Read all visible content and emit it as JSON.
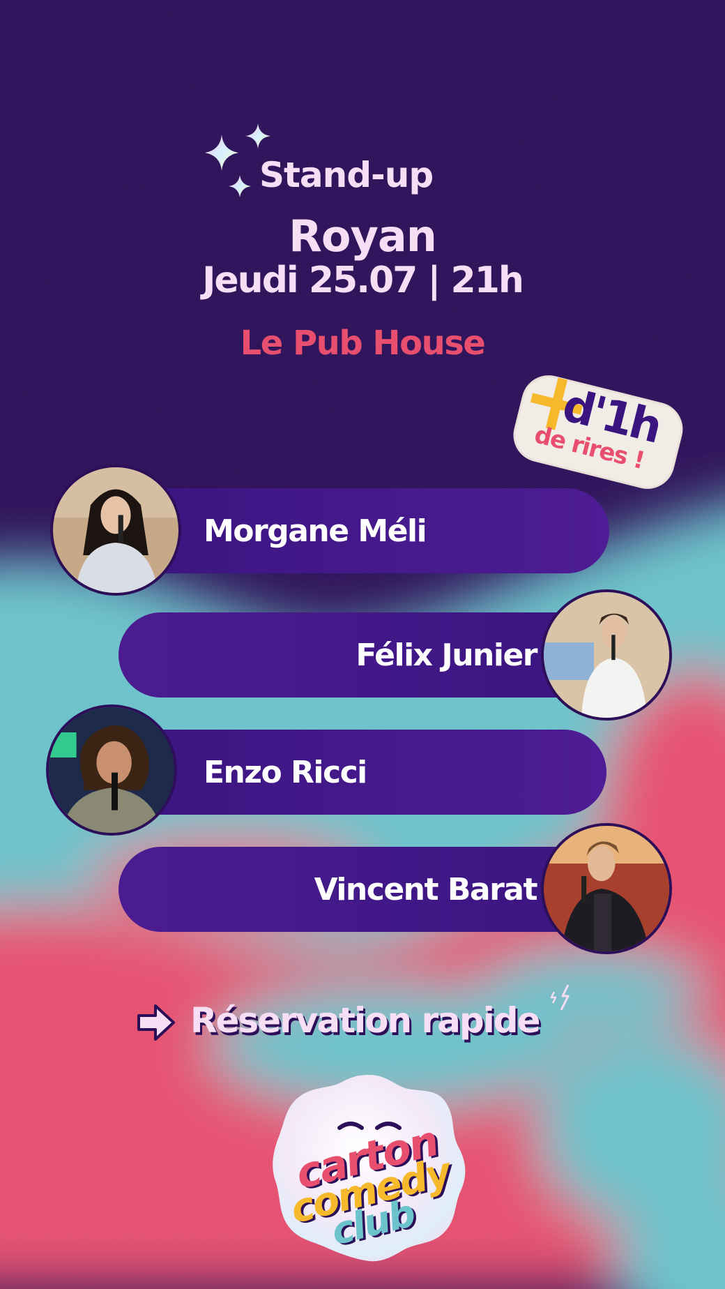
{
  "event": {
    "genre": "Stand-up",
    "city": "Royan",
    "datetime": "Jeudi 25.07 | 21h",
    "venue": "Le Pub House"
  },
  "sticker": {
    "prefix": "+",
    "duration": "d'1h",
    "tagline": "de rires !"
  },
  "comedians": [
    {
      "name": "Morgane Méli",
      "side": "left"
    },
    {
      "name": "Félix Junier",
      "side": "right"
    },
    {
      "name": "Enzo Ricci",
      "side": "left"
    },
    {
      "name": "Vincent Barat",
      "side": "right"
    }
  ],
  "cta": {
    "label": "Réservation rapide",
    "icon": "arrow-right-icon"
  },
  "logo": {
    "line1": "carton",
    "line2": "comedy",
    "line3": "club"
  },
  "colors": {
    "background": "#2c0f58",
    "pill": "#4b1c91",
    "venue": "#e84f6f",
    "text": "#f6def4",
    "teal": "#6cc3cc",
    "coral": "#e84f6f",
    "yellow": "#f6b92b"
  }
}
